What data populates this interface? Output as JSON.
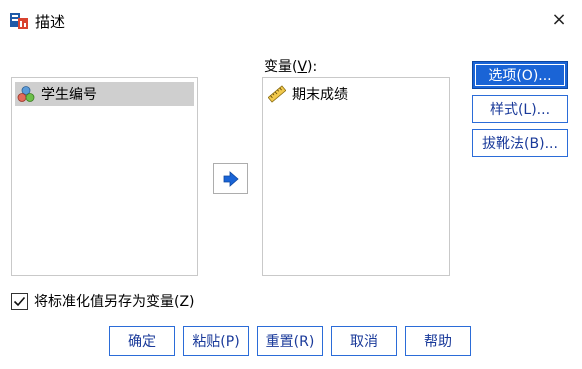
{
  "window": {
    "title": "描述",
    "close_glyph": "×",
    "icon": "descriptives-app-icon"
  },
  "source_list": {
    "items": [
      {
        "label": "学生编号",
        "icon": "nominal-variable-icon"
      }
    ]
  },
  "variables": {
    "label_prefix": "变量(",
    "mnemonic": "V",
    "label_suffix": "):",
    "items": [
      {
        "label": "期末成绩",
        "icon": "scale-variable-icon"
      }
    ]
  },
  "move_button": {
    "icon": "arrow-right-icon"
  },
  "side_buttons": {
    "options": "选项(O)...",
    "style": "样式(L)...",
    "bootstrap": "拔靴法(B)..."
  },
  "save_standardized": {
    "checked": true,
    "label": "将标准化值另存为变量(Z)"
  },
  "bottom_buttons": {
    "ok": "确定",
    "paste": "粘贴(P)",
    "reset": "重置(R)",
    "cancel": "取消",
    "help": "帮助"
  },
  "colors": {
    "primary_button": "#1a64d6",
    "button_border": "#2b6cd8",
    "selected_item": "#cfcfcf",
    "arrow": "#1a64d6"
  }
}
